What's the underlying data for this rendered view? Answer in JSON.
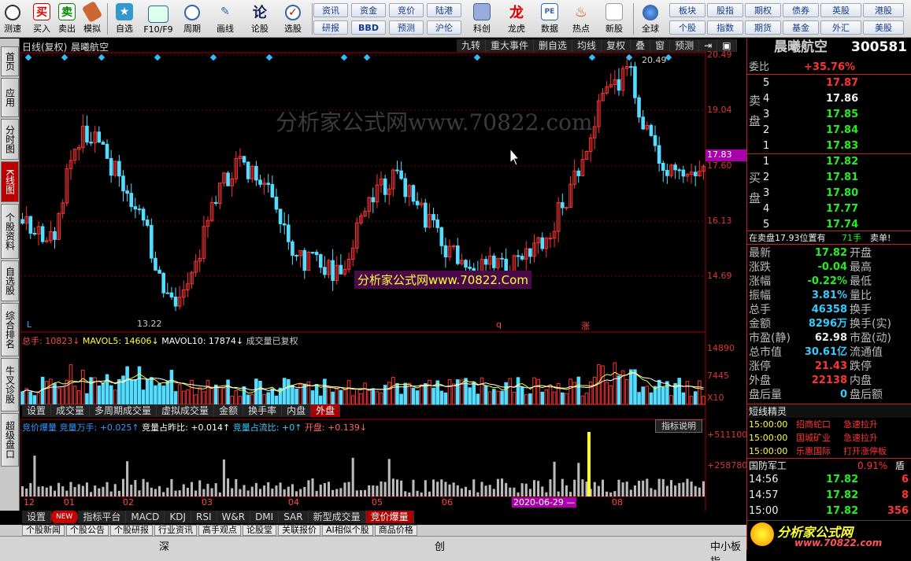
{
  "toolbar": {
    "buttons": [
      {
        "label": "测速",
        "icon": "clock-icon"
      },
      {
        "label": "买入",
        "icon": "buy-icon"
      },
      {
        "label": "卖出",
        "icon": "sell-icon"
      },
      {
        "label": "模拟",
        "icon": "hammer-icon"
      },
      {
        "label": "自选",
        "icon": "star-icon"
      },
      {
        "label": "F10/F9",
        "icon": "f10-icon"
      },
      {
        "label": "周期",
        "icon": "period-icon"
      },
      {
        "label": "画线",
        "icon": "pen-icon"
      },
      {
        "label": "论股",
        "icon": "discuss-icon"
      },
      {
        "label": "选股",
        "icon": "select-icon"
      },
      {
        "label": "科创",
        "icon": "kechuang-icon"
      },
      {
        "label": "龙虎",
        "icon": "dragon-icon"
      },
      {
        "label": "数据",
        "icon": "pe-icon"
      },
      {
        "label": "热点",
        "icon": "fire-icon"
      },
      {
        "label": "新股",
        "icon": "newstock-icon"
      },
      {
        "label": "全球",
        "icon": "globe-icon"
      }
    ],
    "buy_glyph": "买",
    "sell_glyph": "卖",
    "grid1": [
      "资讯",
      "资金",
      "竞价",
      "陆港"
    ],
    "grid1b": [
      "研报",
      "BBD",
      "预测",
      "沪伦"
    ],
    "grid2": [
      "板块",
      "股指",
      "期权",
      "债券",
      "英股",
      "港股"
    ],
    "grid2b": [
      "个股",
      "指数",
      "期货",
      "基金",
      "外汇",
      "美股"
    ]
  },
  "left_tabs": [
    "首页",
    "应用",
    "分时图",
    "K线图",
    "个股资料",
    "自选股",
    "综合排名",
    "牛叉诊股",
    "超级盘口"
  ],
  "chart": {
    "title": "日线(复权)",
    "stock_name": "晨曦航空",
    "top_buttons": [
      "九转",
      "重大事件",
      "删自选",
      "均线",
      "复权",
      "叠",
      "窗",
      "预测"
    ],
    "price_labels": [
      "20.49",
      "19.04",
      "17.60",
      "16.13",
      "14.69"
    ],
    "current_price_tag": "17.83",
    "high_mark": "20.49",
    "low_mark": "13.22",
    "watermark1": "分析家公式网www.70822.com",
    "watermark2": "分析家公式网www.70822.Com",
    "marker_l": "L",
    "marker_q": "q",
    "marker_zhang": "涨",
    "vol_header": {
      "a": "总手: ",
      "a_val": "10823↓",
      "b": "MAVOL5: ",
      "b_val": "14606↓",
      "c": "MAVOL10: ",
      "c_val": "17874↓",
      "d": "成交量已复权"
    },
    "vol_labels": [
      "14890",
      "7445",
      "X10"
    ],
    "mid_tabs": [
      "设置",
      "成交量",
      "多周期成交量",
      "虚拟成交量",
      "金额",
      "换手率",
      "内盘",
      "外盘"
    ],
    "ind_header": {
      "a": "竞价爆量",
      "b": "竞量万手: +0.025↑",
      "c": "竞量占昨比: +0.014↑",
      "d": "竞量占流比: +0↑",
      "e": "开盘: +0.139↓"
    },
    "ind_btn": "指标说明",
    "ind_labels": [
      "+511100",
      "+258780"
    ],
    "x_axis": [
      "12",
      "01",
      "02",
      "03",
      "04",
      "05",
      "06",
      "08"
    ],
    "date_cursor": "2020-06-29 —",
    "bottom_tabs": [
      "设置",
      "NEW",
      "指标平台",
      "MACD",
      "KDJ",
      "RSI",
      "W&R",
      "DMI",
      "SAR",
      "新型成交量",
      "竞价爆量"
    ],
    "bottom_row2": [
      "个股新闻",
      "个股公告",
      "个股研报",
      "行业资讯",
      "高手观点",
      "论股堂",
      "关联报价",
      "AI相似个股",
      "商品价格"
    ],
    "status_left": "深",
    "status_mid": "创",
    "status_right": "中小板指"
  },
  "panel": {
    "name": "晨曦航空",
    "code": "300581",
    "weibi_label": "委比",
    "weibi_val": "+35.76%",
    "sell": [
      {
        "n": "5",
        "p": "17.87",
        "c": "red"
      },
      {
        "n": "4",
        "p": "17.86",
        "c": "white"
      },
      {
        "n": "3",
        "p": "17.85",
        "c": "green"
      },
      {
        "n": "2",
        "p": "17.84",
        "c": "green"
      },
      {
        "n": "1",
        "p": "17.83",
        "c": "green"
      }
    ],
    "buy": [
      {
        "n": "1",
        "p": "17.82",
        "c": "green"
      },
      {
        "n": "2",
        "p": "17.81",
        "c": "green"
      },
      {
        "n": "3",
        "p": "17.80",
        "c": "green"
      },
      {
        "n": "4",
        "p": "17.77",
        "c": "green"
      },
      {
        "n": "5",
        "p": "17.74",
        "c": "green"
      }
    ],
    "sell_label": "卖盘",
    "buy_label": "买盘",
    "notice": "在卖盘17.93位置有",
    "notice_val": "71手",
    "notice_tail": "卖单!",
    "quotes": [
      {
        "l": "最新",
        "v": "17.82",
        "vc": "green",
        "r": "开盘"
      },
      {
        "l": "涨跌",
        "v": "-0.04",
        "vc": "green",
        "r": "最高"
      },
      {
        "l": "涨幅",
        "v": "-0.22%",
        "vc": "green",
        "r": "最低"
      },
      {
        "l": "振幅",
        "v": "3.81%",
        "vc": "cyan",
        "r": "量比"
      },
      {
        "l": "总手",
        "v": "46358",
        "vc": "cyan",
        "r": "换手"
      },
      {
        "l": "金额",
        "v": "8296万",
        "vc": "cyan",
        "r": "换手(实)"
      },
      {
        "l": "市盈(静)",
        "v": "62.98",
        "vc": "white",
        "r": "市盈(动)"
      },
      {
        "l": "总市值",
        "v": "30.61亿",
        "vc": "cyan",
        "r": "流通值"
      },
      {
        "l": "涨停",
        "v": "21.43",
        "vc": "red",
        "r": "跌停"
      },
      {
        "l": "外盘",
        "v": "22138",
        "vc": "red",
        "r": "内盘"
      },
      {
        "l": "盘后量",
        "v": "0",
        "vc": "cyan",
        "r": "盘后额"
      }
    ],
    "sprite_title": "短线精灵",
    "sprite": [
      {
        "t": "15:00:00",
        "n": "招商蛇口",
        "e": "急速拉升"
      },
      {
        "t": "15:00:00",
        "n": "国城矿业",
        "e": "急速拉升"
      },
      {
        "t": "15:00:00",
        "n": "乐惠国际",
        "e": "打开涨停板"
      }
    ],
    "sector": "国防军工",
    "sector_val": "0.91%",
    "sector_tail": "盾",
    "ticks": [
      {
        "t": "14:56",
        "p": "17.82",
        "v": "6"
      },
      {
        "t": "14:57",
        "p": "17.82",
        "v": "8"
      },
      {
        "t": "15:00",
        "p": "17.82",
        "v": "356"
      }
    ],
    "logo_text": "分析家公式网",
    "logo_url": "www.70822.com"
  },
  "colors": {
    "up": "#ff3333",
    "down": "#55ddff",
    "bg": "#000000",
    "accent": "#bb0000"
  }
}
